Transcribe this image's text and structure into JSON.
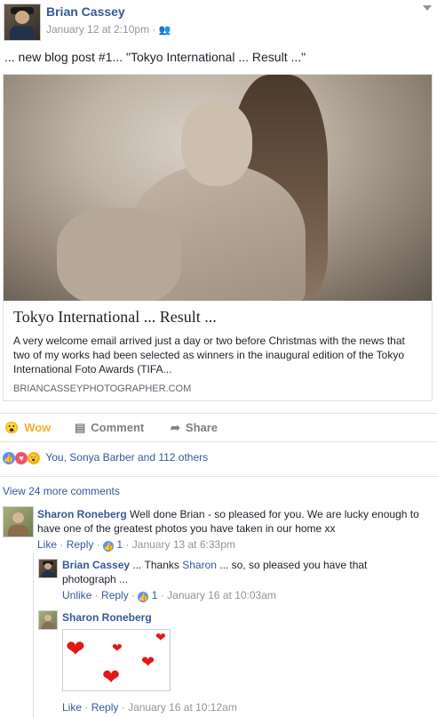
{
  "post": {
    "author": "Brian Cassey",
    "timestamp": "January 12 at 2:10pm",
    "separator": "·",
    "audience_icon": "friends-icon",
    "text": "... new blog post #1... \"Tokyo International ... Result ...\""
  },
  "link_preview": {
    "image": "nude-scarred-woman-photo",
    "title": "Tokyo International ... Result ...",
    "description": "A very welcome email arrived just a day or two before Christmas with the news that two of my works had been selected as winners in the inaugural edition of the Tokyo International Foto Awards (TIFA...",
    "domain": "BRIANCASSEYPHOTOGRAPHER.COM"
  },
  "actions": {
    "wow_label": "Wow",
    "comment_label": "Comment",
    "share_label": "Share"
  },
  "reactions": {
    "summary": "You, Sonya Barber and 112 others",
    "icons": [
      "like-icon",
      "love-icon",
      "wow-icon"
    ]
  },
  "comments": {
    "view_more": "View 24 more comments",
    "items": [
      {
        "author": "Sharon Roneberg",
        "text": "Well done Brian - so pleased for you. We are lucky enough to have one of the greatest photos you have taken in our home xx",
        "like": "Like",
        "reply": "Reply",
        "likes": "1",
        "dot": "·",
        "time": "January 13 at 6:33pm"
      }
    ],
    "replies": [
      {
        "author": "Brian Cassey",
        "text_before": "... Thanks",
        "mention": "Sharon",
        "text_after": "... so, so pleased you have that photograph ...",
        "like": "Unlike",
        "reply": "Reply",
        "likes": "1",
        "dot": "·",
        "time": "January 16 at 10:03am"
      },
      {
        "author": "Sharon Roneberg",
        "sticker": "hearts-sticker",
        "like": "Like",
        "reply": "Reply",
        "dot": "·",
        "time": "January 16 at 10:12am"
      }
    ]
  },
  "colors": {
    "link": "#365899",
    "muted": "#90949c",
    "wow": "#f7b125",
    "like_blue": "#5890ff",
    "love_red": "#f25268"
  }
}
